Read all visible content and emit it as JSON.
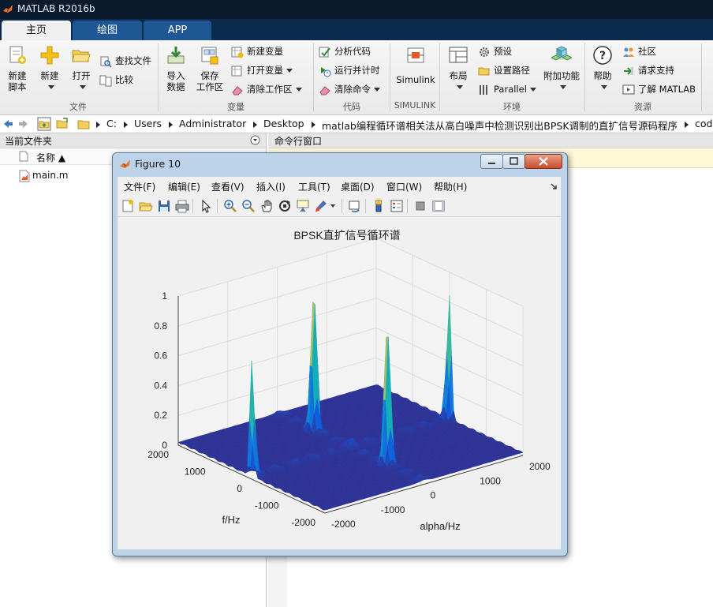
{
  "app": {
    "title": "MATLAB R2016b"
  },
  "tabs": [
    {
      "label": "主页"
    },
    {
      "label": "绘图"
    },
    {
      "label": "APP"
    }
  ],
  "ribbon": {
    "file": {
      "new_script": [
        "新建",
        "脚本"
      ],
      "new": "新建",
      "open": "打开",
      "find_files": "查找文件",
      "compare": "比较",
      "group": "文件"
    },
    "variable": {
      "import": [
        "导入",
        "数据"
      ],
      "save": [
        "保存",
        "工作区"
      ],
      "new_var": "新建变量",
      "open_var": "打开变量",
      "clear_ws": "清除工作区",
      "group": "变量"
    },
    "code": {
      "analyze": "分析代码",
      "run_time": "运行并计时",
      "clear_cmd": "清除命令",
      "group": "代码"
    },
    "simulink": {
      "label": "Simulink",
      "group": "SIMULINK"
    },
    "env": {
      "layout": "布局",
      "prefs": "预设",
      "set_path": "设置路径",
      "parallel": "Parallel",
      "addons": "附加功能",
      "group": "环境"
    },
    "resources": {
      "help": "帮助",
      "community": "社区",
      "support": "请求支持",
      "learn": "了解 MATLAB",
      "group": "资源"
    }
  },
  "address": {
    "crumbs": [
      "C:",
      "Users",
      "Administrator",
      "Desktop",
      "matlab编程循环谱相关法从高白噪声中检测识别出BPSK调制的直扩信号源码程序",
      "code"
    ]
  },
  "current_folder": {
    "title": "当前文件夹",
    "name_col": "名称 ▲",
    "files": [
      "main.m"
    ]
  },
  "command_window": {
    "title": "命令行窗口"
  },
  "figure": {
    "title": "Figure 10",
    "menu": [
      "文件(F)",
      "编辑(E)",
      "查看(V)",
      "插入(I)",
      "工具(T)",
      "桌面(D)",
      "窗口(W)",
      "帮助(H)"
    ]
  },
  "chart_data": {
    "type": "surface",
    "title": "BPSK直扩信号循环谱",
    "xlabel": "alpha/Hz",
    "ylabel": "f/Hz",
    "zlabel": "",
    "x_ticks": [
      -2000,
      -1000,
      0,
      1000,
      2000
    ],
    "y_ticks": [
      -2000,
      -1000,
      0,
      1000,
      2000
    ],
    "z_ticks": [
      0,
      0.2,
      0.4,
      0.6,
      0.8,
      1
    ],
    "xlim": [
      -2000,
      2000
    ],
    "ylim": [
      -2000,
      2000
    ],
    "zlim": [
      0,
      1
    ],
    "colormap": "parula",
    "peaks": [
      {
        "alpha": 0,
        "f": 1000,
        "z": 1.0
      },
      {
        "alpha": 0,
        "f": -1000,
        "z": 1.0
      },
      {
        "alpha": -2000,
        "f": 0,
        "z": 0.76
      },
      {
        "alpha": 2000,
        "f": 0,
        "z": 0.82
      }
    ],
    "grid": true
  }
}
